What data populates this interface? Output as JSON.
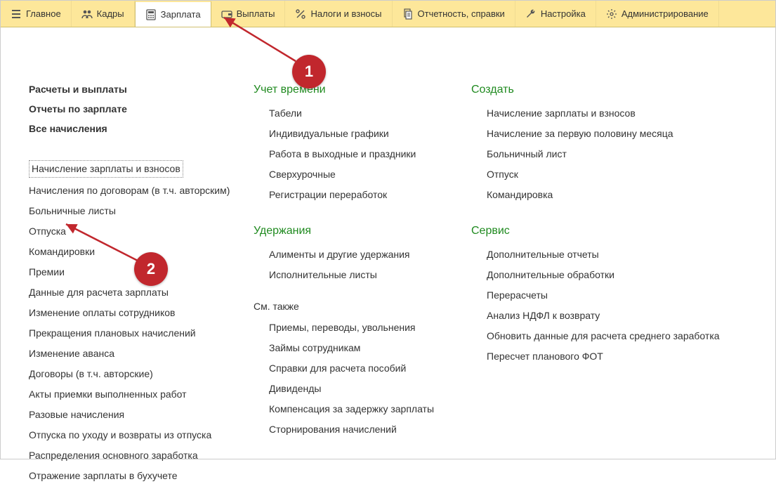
{
  "toolbar": [
    {
      "label": "Главное",
      "icon": "menu"
    },
    {
      "label": "Кадры",
      "icon": "people"
    },
    {
      "label": "Зарплата",
      "icon": "calc",
      "active": true
    },
    {
      "label": "Выплаты",
      "icon": "wallet"
    },
    {
      "label": "Налоги и взносы",
      "icon": "percent"
    },
    {
      "label": "Отчетность, справки",
      "icon": "docs"
    },
    {
      "label": "Настройка",
      "icon": "wrench"
    },
    {
      "label": "Администрирование",
      "icon": "gear"
    }
  ],
  "col1": {
    "bold": [
      "Расчеты и выплаты",
      "Отчеты по зарплате",
      "Все начисления"
    ],
    "links": [
      {
        "text": "Начисление зарплаты и взносов",
        "selected": true
      },
      {
        "text": "Начисления по договорам (в т.ч. авторским)"
      },
      {
        "text": "Больничные листы"
      },
      {
        "text": "Отпуска"
      },
      {
        "text": "Командировки"
      },
      {
        "text": "Премии"
      },
      {
        "text": "Данные для расчета зарплаты"
      },
      {
        "text": "Изменение оплаты сотрудников"
      },
      {
        "text": "Прекращения плановых начислений"
      },
      {
        "text": "Изменение аванса"
      },
      {
        "text": "Договоры (в т.ч. авторские)"
      },
      {
        "text": "Акты приемки выполненных работ"
      },
      {
        "text": "Разовые начисления"
      },
      {
        "text": "Отпуска по уходу и возвраты из отпуска"
      },
      {
        "text": "Распределения основного заработка"
      },
      {
        "text": "Отражение зарплаты в бухучете"
      }
    ]
  },
  "col2": {
    "sections": [
      {
        "header": "Учет времени",
        "items": [
          "Табели",
          "Индивидуальные графики",
          "Работа в выходные и праздники",
          "Сверхурочные",
          "Регистрации переработок"
        ]
      },
      {
        "header": "Удержания",
        "items": [
          "Алименты и другие удержания",
          "Исполнительные листы"
        ]
      }
    ],
    "seealso_label": "См. также",
    "seealso": [
      "Приемы, переводы, увольнения",
      "Займы сотрудникам",
      "Справки для расчета пособий",
      "Дивиденды",
      "Компенсация за задержку зарплаты",
      "Сторнирования начислений"
    ]
  },
  "col3": {
    "sections": [
      {
        "header": "Создать",
        "items": [
          "Начисление зарплаты и взносов",
          "Начисление за первую половину месяца",
          "Больничный лист",
          "Отпуск",
          "Командировка"
        ]
      },
      {
        "header": "Сервис",
        "items": [
          "Дополнительные отчеты",
          "Дополнительные обработки",
          "Перерасчеты",
          "Анализ НДФЛ к возврату",
          "Обновить данные для расчета среднего заработка",
          "Пересчет планового ФОТ"
        ]
      }
    ]
  },
  "annotations": {
    "badge1": "1",
    "badge2": "2"
  }
}
